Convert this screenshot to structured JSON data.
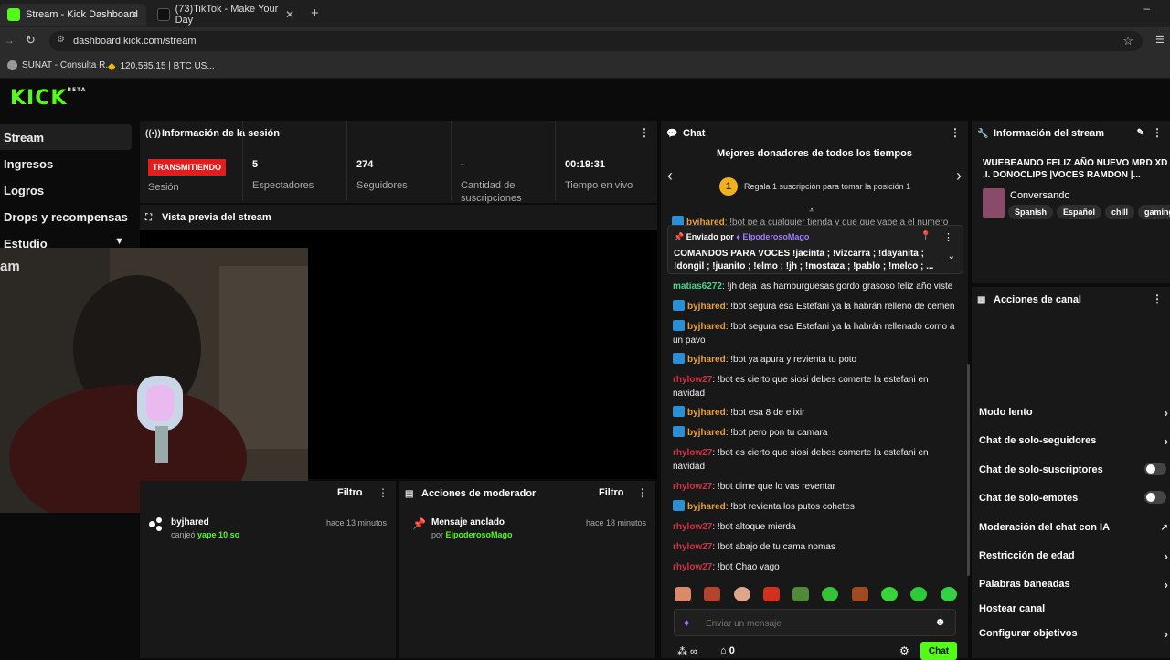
{
  "browser": {
    "tabs": [
      {
        "title": "Stream - Kick Dashboard"
      },
      {
        "title": "(73)TikTok - Make Your Day"
      }
    ],
    "url": "dashboard.kick.com/stream",
    "bookmarks": [
      {
        "label": "SUNAT - Consulta R..."
      },
      {
        "label": "120,585.15 | BTC US..."
      }
    ]
  },
  "logo": {
    "text": "KICK",
    "beta": "BETA"
  },
  "sidebar": {
    "items": [
      {
        "label": "Stream"
      },
      {
        "label": "Ingresos"
      },
      {
        "label": "Logros"
      },
      {
        "label": "Drops y recompensas"
      },
      {
        "label": "Estudio"
      }
    ]
  },
  "session": {
    "title": "Información de la sesión",
    "status": "TRANSMITIENDO",
    "status_label": "Sesión",
    "stats": [
      {
        "value": "5",
        "label": "Espectadores"
      },
      {
        "value": "274",
        "label": "Seguidores"
      },
      {
        "value": "-",
        "label": "Cantidad de suscripciones"
      },
      {
        "value": "00:19:31",
        "label": "Tiempo en vivo"
      }
    ]
  },
  "preview": {
    "title": "Vista previa del stream",
    "overlay_text": "am"
  },
  "activity": {
    "filter_label": "Filtro",
    "user": "byjhared",
    "action": "canjeó",
    "reward": "yape 10 so",
    "time": "hace 13 minutos"
  },
  "mod_actions": {
    "title": "Acciones de moderador",
    "filter_label": "Filtro",
    "item_title": "Mensaje anclado",
    "item_by": "por",
    "item_user": "ElpoderosoMago",
    "time": "hace 18 minutos"
  },
  "chat": {
    "title": "Chat",
    "donors_title": "Mejores donadores de todos los tiempos",
    "donors_rank": "1",
    "donors_sub": "Regala 1 suscripción para tomar la posición 1",
    "cut_line_user": "byjhared",
    "cut_line_text": ": !bot pe a cualquier tienda y que que vape a el numero",
    "pinned_label": "Enviado por",
    "pinned_user": "ElpoderosoMago",
    "pinned_text": "COMANDOS PARA VOCES !jacinta ; !vizcarra ; !dayanita ; !dongil ; !juanito ; !elmo ; !jh ; !mostaza ; !pablo ; !melco ; ...",
    "messages": [
      {
        "user": "matias6272",
        "text": ": !jh deja las hamburguesas gordo grasoso feliz año viste"
      },
      {
        "user": "byjhared",
        "text": ": !bot segura esa Estefani ya la habrán relleno de cemen"
      },
      {
        "user": "byjhared",
        "text": ": !bot segura esa Estefani ya la habrán rellenado como a un pavo"
      },
      {
        "user": "byjhared",
        "text": ": !bot ya apura y revienta tu poto"
      },
      {
        "user": "rhylow27",
        "text": ": !bot es cierto que siosi debes comerte la estefani en navidad"
      },
      {
        "user": "byjhared",
        "text": ": !bot esa 8 de elixir"
      },
      {
        "user": "byjhared",
        "text": ": !bot pero pon tu camara"
      },
      {
        "user": "rhylow27",
        "text": ": !bot es cierto que siosi debes comerte la estefani en navidad"
      },
      {
        "user": "rhylow27",
        "text": ": !bot dime que lo vas reventar"
      },
      {
        "user": "byjhared",
        "text": ": !bot revienta los putos cohetes"
      },
      {
        "user": "rhylow27",
        "text": ": !bot altoque mierda"
      },
      {
        "user": "rhylow27",
        "text": ": !bot abajo de tu cama nomas"
      },
      {
        "user": "rhylow27",
        "text": ": !bot Chao vago"
      }
    ],
    "input_placeholder": "Enviar un mensaje",
    "footer_count": "0",
    "send_label": "Chat"
  },
  "stream_info": {
    "title": "Información del stream",
    "stream_title": "WUEBEANDO FELIZ AÑO NUEVO MRD XD .I. DONOCLIPS |VOCES RAMDON |...",
    "category": "Conversando",
    "tags": [
      "Spanish",
      "Español",
      "chill",
      "gaming"
    ]
  },
  "channel_actions": {
    "title": "Acciones de canal",
    "items": [
      {
        "label": "Modo lento",
        "control": "chevron"
      },
      {
        "label": "Chat de solo-seguidores",
        "control": "chevron"
      },
      {
        "label": "Chat de solo-suscriptores",
        "control": "toggle"
      },
      {
        "label": "Chat de solo-emotes",
        "control": "toggle"
      },
      {
        "label": "Moderación del chat con IA",
        "control": "external"
      },
      {
        "label": "Restricción de edad",
        "control": "chevron"
      },
      {
        "label": "Palabras baneadas",
        "control": "chevron"
      },
      {
        "label": "Hostear canal",
        "control": "none"
      },
      {
        "label": "Configurar objetivos",
        "control": "chevron"
      }
    ]
  },
  "colors": {
    "accent": "#53fc18",
    "live": "#e01e1e"
  }
}
